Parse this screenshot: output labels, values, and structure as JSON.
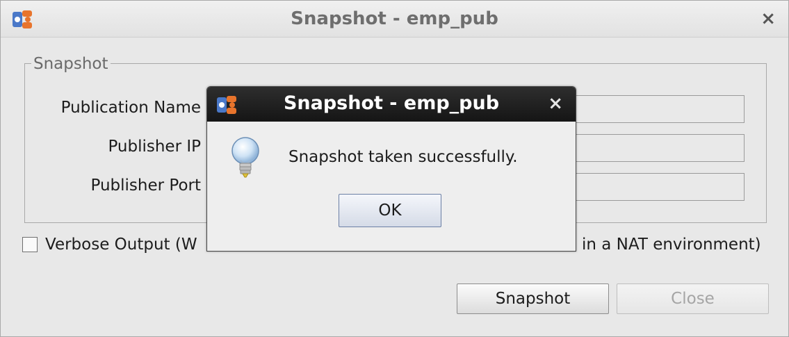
{
  "main_window": {
    "title": "Snapshot - emp_pub",
    "close_glyph": "×",
    "group_title": "Snapshot",
    "fields": [
      {
        "label": "Publication Name",
        "value": ""
      },
      {
        "label": "Publisher IP",
        "value": ""
      },
      {
        "label": "Publisher Port",
        "value": ""
      }
    ],
    "verbose_label": "Verbose Output  (W",
    "verbose_label_tail": "in a NAT environment)",
    "verbose_checked": false,
    "buttons": {
      "snapshot": "Snapshot",
      "close": "Close"
    }
  },
  "dialog": {
    "title": "Snapshot - emp_pub",
    "close_glyph": "×",
    "message": "Snapshot taken successfully.",
    "ok_label": "OK",
    "icon": "lightbulb-info-icon"
  },
  "colors": {
    "app_icon_orange": "#e8742c",
    "app_icon_blue": "#4a78c8",
    "dialog_title_bg": "#1e1e1e"
  }
}
